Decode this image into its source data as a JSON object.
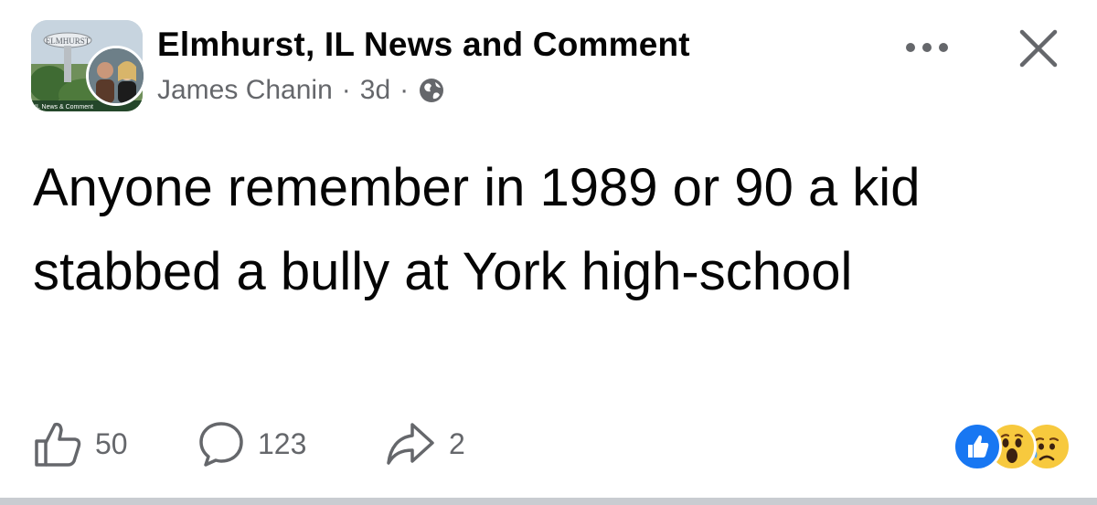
{
  "header": {
    "group_name": "Elmhurst, IL News and Comment",
    "author": "James Chanin",
    "separator": "·",
    "time": "3d",
    "privacy_icon": "globe-icon",
    "group_avatar": {
      "top_text": "ELMHURST",
      "bottom_text": "IL News & Comment"
    },
    "more_icon": "more-horizontal-icon",
    "close_icon": "close-icon"
  },
  "post": {
    "text": "Anyone remember in 1989 or 90 a kid stabbed a bully at York high-school"
  },
  "footer": {
    "like_count": "50",
    "comment_count": "123",
    "share_count": "2",
    "like_icon": "thumbs-up-icon",
    "comment_icon": "comment-bubble-icon",
    "share_icon": "share-arrow-icon",
    "reactions": [
      "like",
      "wow",
      "sad"
    ]
  },
  "colors": {
    "text_primary": "#050505",
    "text_secondary": "#65676b",
    "like_blue": "#1877f2",
    "emoji_yellow": "#f7c93e",
    "divider": "#c9ccd1"
  }
}
